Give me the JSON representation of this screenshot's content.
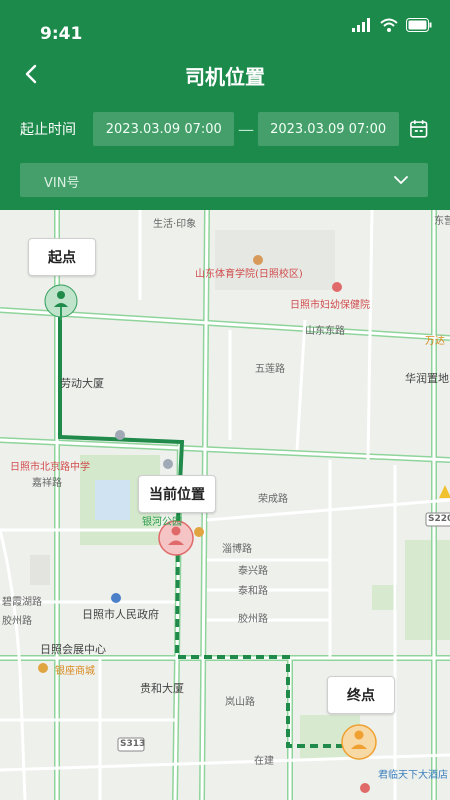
{
  "status": {
    "time": "9:41"
  },
  "nav": {
    "title": "司机位置"
  },
  "filter": {
    "label": "起止时间",
    "start": "2023.03.09 07:00",
    "separator": "—",
    "end": "2023.03.09 07:00"
  },
  "vin": {
    "placeholder": "VIN号"
  },
  "map": {
    "markers": {
      "start": "起点",
      "current": "当前位置",
      "end": "终点"
    },
    "labels": {
      "l1": "生活·印象",
      "l2": "山东体育学院(日照校区)",
      "l3": "日照市妇幼保健院",
      "l4": "山东东路",
      "l5": "万达",
      "l6": "五莲路",
      "l7": "华润置地",
      "l8": "劳动大厦",
      "l9": "日照市北京路中学",
      "l10": "嘉祥路",
      "l11": "荣成路",
      "l12": "银河公园",
      "l13": "淄博路",
      "l14": "泰兴路",
      "l15": "泰和路",
      "l16": "碧霞湖路",
      "l17": "胶州路",
      "l18": "胶州路",
      "l19": "日照市人民政府",
      "l20": "日照会展中心",
      "l21": "银座商城",
      "l22": "贵和大厦",
      "l23": "岚山路",
      "l24": "S313",
      "l25": "S220",
      "l26": "君临天下大酒店",
      "l27": "东营",
      "l28": "在建"
    }
  },
  "colors": {
    "brand": "#1c8a4b",
    "route": "#1f8a4a",
    "start_marker": "#2f9e5a",
    "current_marker": "#e06a6a",
    "end_marker": "#f0a030"
  }
}
